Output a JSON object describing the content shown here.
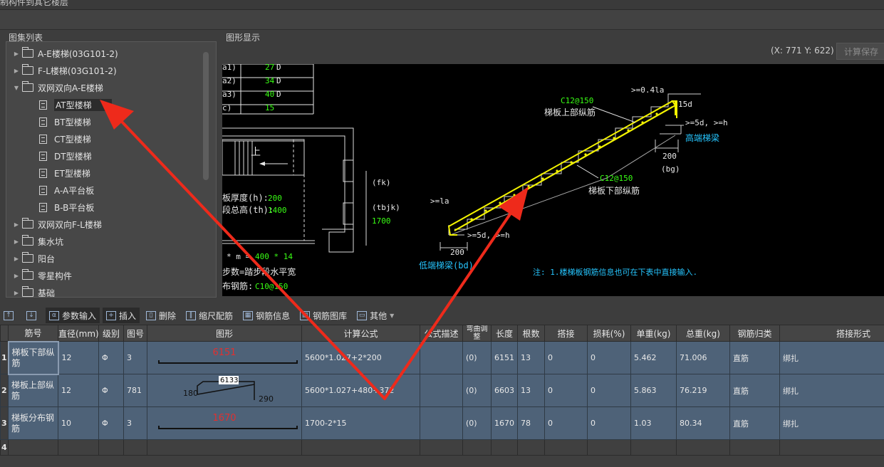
{
  "window": {
    "title_fragment": "制构件到其它楼层"
  },
  "tree": {
    "title": "图集列表",
    "items": [
      {
        "label": "A-E楼梯(03G101-2)",
        "type": "folder"
      },
      {
        "label": "F-L楼梯(03G101-2)",
        "type": "folder"
      },
      {
        "label": "双网双向A-E楼梯",
        "type": "folder",
        "expanded": true
      },
      {
        "label": "AT型楼梯",
        "type": "doc",
        "selected": true
      },
      {
        "label": "BT型楼梯",
        "type": "doc"
      },
      {
        "label": "CT型楼梯",
        "type": "doc"
      },
      {
        "label": "DT型楼梯",
        "type": "doc"
      },
      {
        "label": "ET型楼梯",
        "type": "doc"
      },
      {
        "label": "A-A平台板",
        "type": "doc"
      },
      {
        "label": "B-B平台板",
        "type": "doc"
      },
      {
        "label": "双网双向F-L楼梯",
        "type": "folder"
      },
      {
        "label": "集水坑",
        "type": "folder"
      },
      {
        "label": "阳台",
        "type": "folder"
      },
      {
        "label": "零星构件",
        "type": "folder"
      },
      {
        "label": "基础",
        "type": "folder"
      }
    ]
  },
  "graphic": {
    "title": "图形显示",
    "coords": "(X: 771 Y: 622)",
    "save_label": "计算保存",
    "drawing": {
      "table_rows": [
        {
          "key": "a1)",
          "val": "27",
          "unit": "D"
        },
        {
          "key": "a2)",
          "val": "34",
          "unit": "D"
        },
        {
          "key": "a3)",
          "val": "40",
          "unit": "D"
        },
        {
          "key": "c)",
          "val": "15",
          "unit": ""
        }
      ],
      "up_label": "上",
      "thickness_label": "板厚度(h):",
      "thickness_value": "200",
      "height_label": "段总高(th):",
      "height_value": "1400",
      "fk": "(fk)",
      "tbjk": "(tbjk)",
      "tbjk_value": "1700",
      "steps_label": "* m =",
      "steps_value": "400 * 14",
      "step_formula": "步数=踏步段水平宽",
      "dist_label": "布钢筋:",
      "dist_value": "C10@150",
      "top_bar_spec": "C12@150",
      "top_bar_label": "梯板上部纵筋",
      "bottom_bar_spec": "C12@150",
      "bottom_bar_label": "梯板下部纵筋",
      "anchor_top": ">=0.4la",
      "fifteen_d": "15d",
      "five_d_top": ">=5d, >=h",
      "high_beam": "高端梯梁",
      "bg_value": "200",
      "bg": "(bg)",
      "la": ">=la",
      "five_d_bottom": ">=5d, >=h",
      "bd_value": "200",
      "low_beam": "低端梯梁(bd)",
      "note": "注: 1.楼梯板钢筋信息也可在下表中直接输入."
    }
  },
  "toolbar": {
    "param_input": "参数输入",
    "insert": "插入",
    "delete": "删除",
    "scale_rebar": "缩尺配筋",
    "rebar_info": "钢筋信息",
    "rebar_library": "钢筋图库",
    "other": "其他"
  },
  "table": {
    "headers": [
      "",
      "筋号",
      "直径(mm)",
      "级别",
      "图号",
      "图形",
      "计算公式",
      "公式描述",
      "弯曲调整",
      "长度",
      "根数",
      "搭接",
      "损耗(%)",
      "单重(kg)",
      "总重(kg)",
      "钢筋归类",
      "搭接形式"
    ],
    "rows": [
      {
        "no": "1",
        "name": "梯板下部纵筋",
        "dia": "12",
        "grade": "Φ",
        "fig": "3",
        "shape_value": "6151",
        "formula": "5600*1.027+2*200",
        "desc": "",
        "bend": "(0)",
        "length": "6151",
        "count": "13",
        "lap": "0",
        "loss": "0",
        "unit_w": "5.462",
        "total_w": "71.006",
        "category": "直筋",
        "lap_type": "绑扎"
      },
      {
        "no": "2",
        "name": "梯板上部纵筋",
        "dia": "12",
        "grade": "Φ",
        "fig": "781",
        "shape_left": "180",
        "shape_mid": "6133",
        "shape_right": "290",
        "formula": "5600*1.027+480+372",
        "desc": "",
        "bend": "(0)",
        "length": "6603",
        "count": "13",
        "lap": "0",
        "loss": "0",
        "unit_w": "5.863",
        "total_w": "76.219",
        "category": "直筋",
        "lap_type": "绑扎"
      },
      {
        "no": "3",
        "name": "梯板分布钢筋",
        "dia": "10",
        "grade": "Φ",
        "fig": "3",
        "shape_value": "1670",
        "formula": "1700-2*15",
        "desc": "",
        "bend": "(0)",
        "length": "1670",
        "count": "78",
        "lap": "0",
        "loss": "0",
        "unit_w": "1.03",
        "total_w": "80.34",
        "category": "直筋",
        "lap_type": "绑扎"
      },
      {
        "no": "4"
      }
    ]
  },
  "colors": {
    "cad_bg": "#000000",
    "rebar_yellow": "#f2f200",
    "cad_green": "#39ff14",
    "cad_cyan": "#26c6ff",
    "row_blue": "#4e6278",
    "annotation_red": "#ee2a1b"
  }
}
